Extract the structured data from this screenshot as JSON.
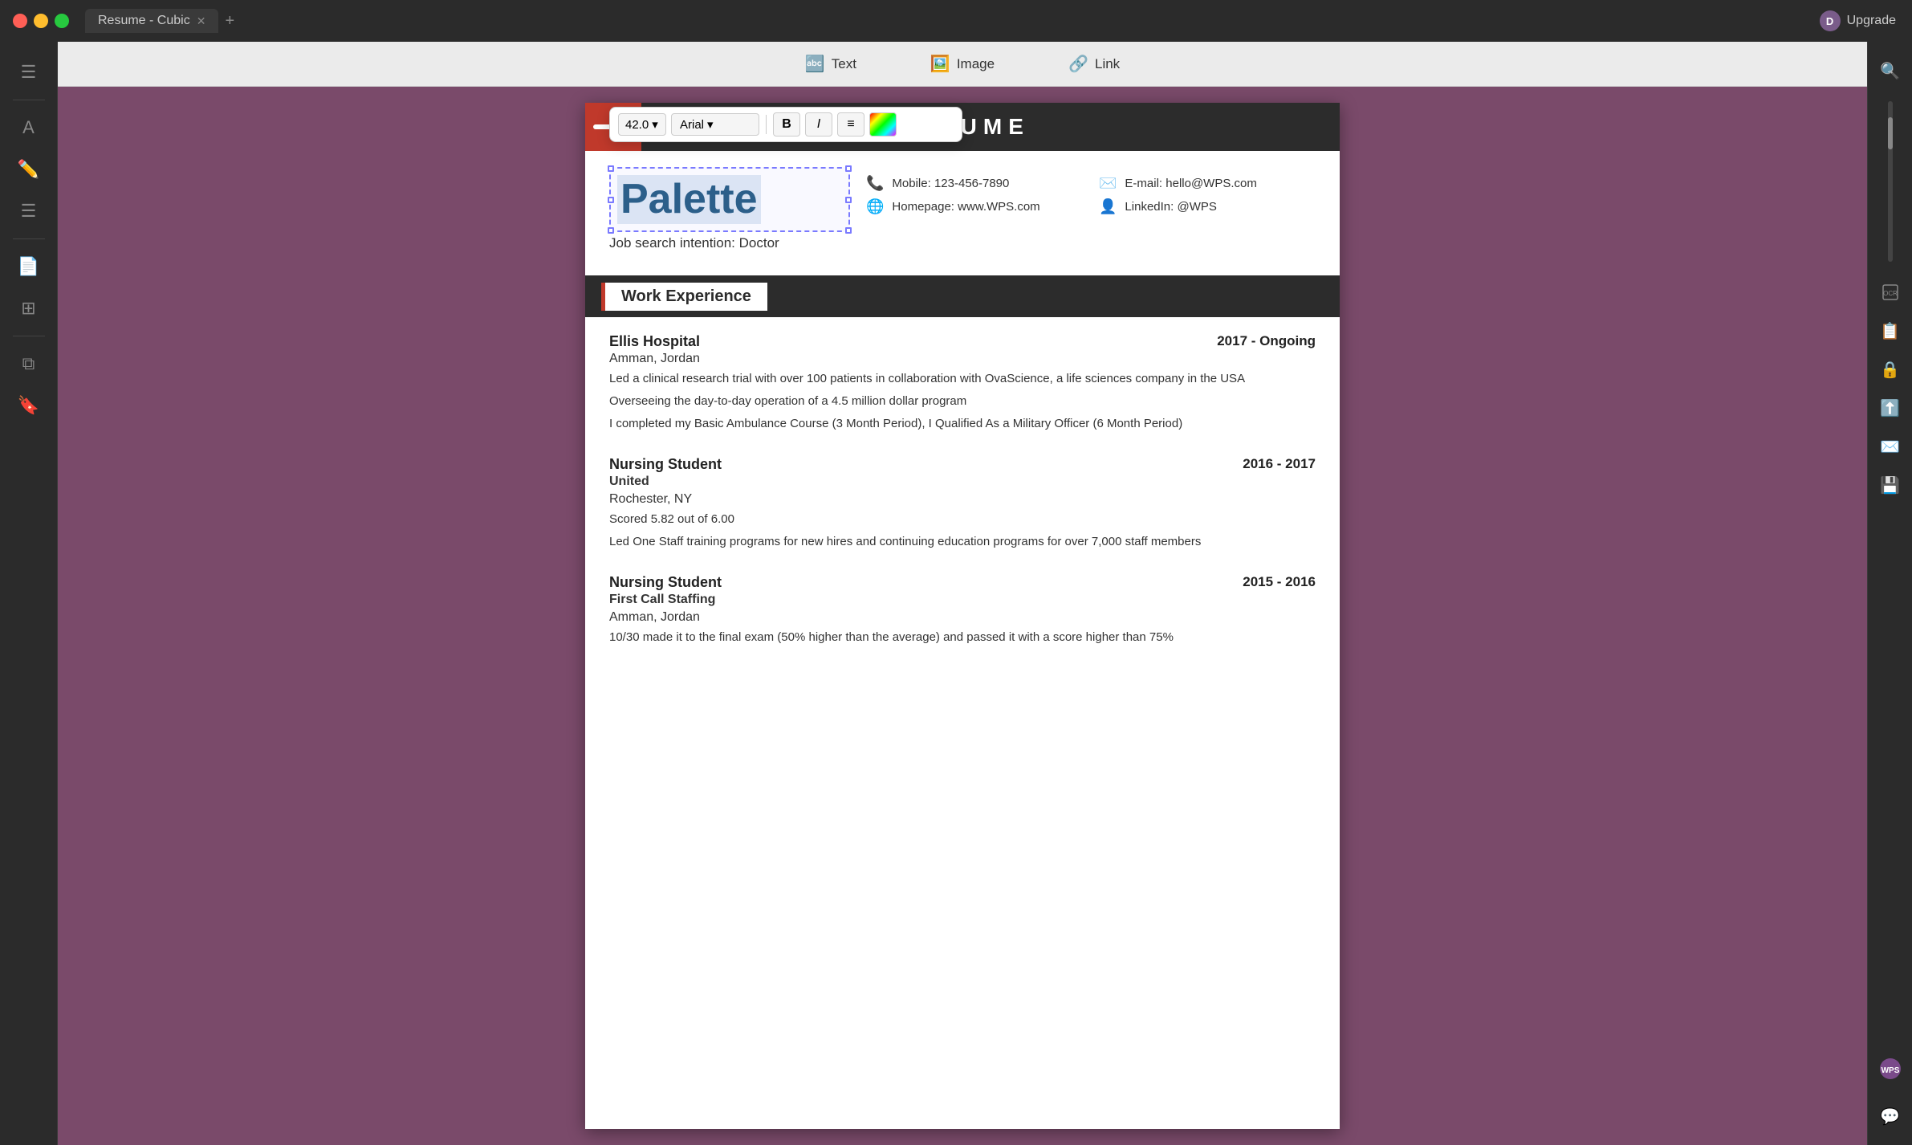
{
  "titlebar": {
    "tab_label": "Resume - Cubic",
    "upgrade_label": "Upgrade",
    "avatar_letter": "D"
  },
  "toolbar": {
    "text_label": "Text",
    "image_label": "Image",
    "link_label": "Link"
  },
  "format_toolbar": {
    "font_size": "42.0",
    "font_family": "Arial",
    "bold_label": "B",
    "italic_label": "I"
  },
  "resume": {
    "header_title": "RESUME",
    "name": "Palette",
    "job_intention_label": "Job search intention:",
    "job_intention_value": "Doctor",
    "mobile_label": "Mobile:",
    "mobile_value": "123-456-7890",
    "email_label": "E-mail:",
    "email_value": "hello@WPS.com",
    "homepage_label": "Homepage:",
    "homepage_value": "www.WPS.com",
    "linkedin_label": "LinkedIn:",
    "linkedin_value": "@WPS",
    "work_experience_title": "Work Experience",
    "work_entries": [
      {
        "company": "Ellis Hospital",
        "date": "2017 - Ongoing",
        "location": "Amman,  Jordan",
        "descriptions": [
          "Led a  clinical research trial with over 100 patients in collaboration with OvaScience, a life sciences company in the USA",
          "Overseeing the day-to-day operation of a 4.5 million dollar program",
          "I completed my Basic Ambulance Course (3 Month Period), I Qualified As a Military Officer (6 Month Period)"
        ]
      },
      {
        "company": "Nursing Student",
        "company2": "United",
        "date": "2016 - 2017",
        "location": "Rochester, NY",
        "descriptions": [
          "Scored 5.82 out of 6.00",
          "Led  One  Staff  training  programs  for  new hires and continuing education programs for over 7,000 staff members"
        ]
      },
      {
        "company": "Nursing Student",
        "company2": "First Call Staffing",
        "date": "2015 - 2016",
        "location": "Amman,  Jordan",
        "descriptions": [
          "10/30  made it to the final exam (50% higher than the average) and passed it with a score  higher than 75%"
        ]
      }
    ]
  }
}
